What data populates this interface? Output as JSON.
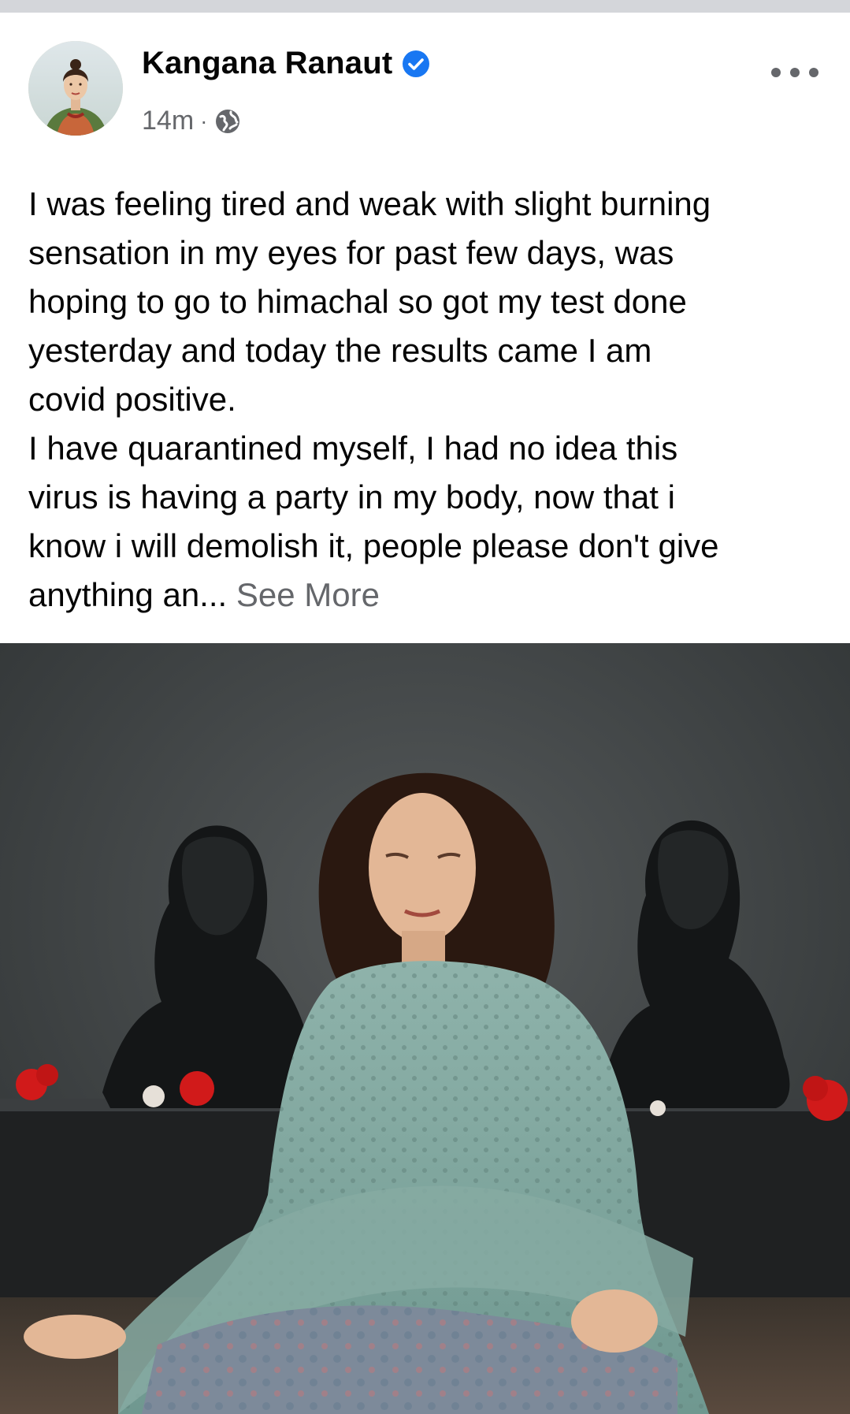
{
  "post": {
    "author": {
      "name": "Kangana Ranaut",
      "verified": true
    },
    "timestamp": "14m",
    "separator": "·",
    "audience_icon": "globe-icon",
    "more_icon": "more-horizontal-icon",
    "text_lines": [
      "I was feeling tired and weak with slight burning",
      "sensation in my eyes for past few days, was",
      "hoping to go to himachal so got my test done",
      "yesterday and today the results came I am",
      "covid positive.",
      "I have quarantined myself, I had no idea this",
      "virus is having a party in my body, now that i",
      "know i will demolish it, people please don't give"
    ],
    "truncated_tail": "anything an... ",
    "see_more_label": "See More",
    "colors": {
      "verified_blue": "#1877f2",
      "secondary_text": "#65676b",
      "primary_text": "#050505"
    }
  }
}
